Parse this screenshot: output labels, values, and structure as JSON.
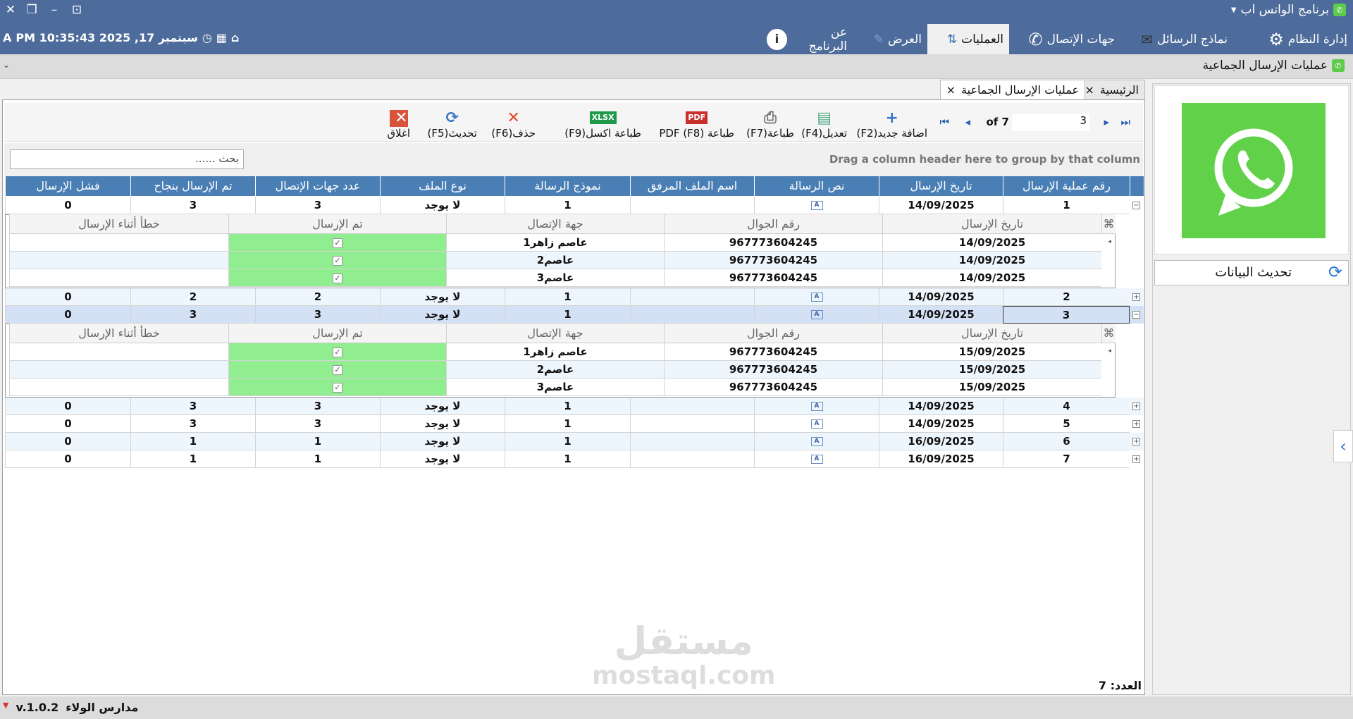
{
  "app": {
    "title": "برنامج الواتس اب",
    "window_controls": [
      "close",
      "restore",
      "minimize",
      "pin"
    ]
  },
  "ribbon": {
    "tabs": [
      {
        "label": "إدارة النظام",
        "icon": "gears-icon"
      },
      {
        "label": "نماذج الرسائل",
        "icon": "envelope-icon"
      },
      {
        "label": "جهات الإتصال",
        "icon": "phone-icon"
      },
      {
        "label": "العمليات",
        "icon": "arrows-updown-icon",
        "active": true
      },
      {
        "label": "العرض",
        "icon": "ruler-pen-icon"
      },
      {
        "label": "عن البرنامج",
        "icon": "info-icon"
      }
    ]
  },
  "clock": {
    "text": "PM 10:35:43 2025 ,17 سبتمبر"
  },
  "breadcrumb": "عمليات الإرسال الجماعية",
  "doc_tabs": [
    {
      "label": "الرئيسية"
    },
    {
      "label": "عمليات الإرسال الجماعية",
      "active": true
    }
  ],
  "toolbar": {
    "add": "اضافة جديد(F2)",
    "edit": "تعديل(F4)",
    "print": "طباعة(F7)",
    "pdf": "طباعة PDF (F8)",
    "excel": "طباعة اكسل(F9)",
    "delete": "حذف(F6)",
    "refresh": "تحديث(F5)",
    "close": "اغلاق",
    "page_current": "3",
    "page_of": "of 7"
  },
  "search": {
    "placeholder": "بحث ......"
  },
  "group_hint": "Drag a column header here to group by that column",
  "grid": {
    "columns": [
      "رقم عملية الإرسال",
      "تاريخ الإرسال",
      "نص الرسالة",
      "اسم الملف المرفق",
      "نموذج الرسالة",
      "نوع الملف",
      "عدد جهات الإتصال",
      "تم الإرسال بنجاح",
      "فشل الإرسال"
    ],
    "rows": [
      {
        "id": "1",
        "date": "14/09/2025",
        "file": "",
        "template": "1",
        "type": "لا يوجد",
        "contacts": "3",
        "success": "3",
        "failed": "0",
        "expanded": true,
        "details": [
          {
            "date": "14/09/2025",
            "phone": "967773604245",
            "contact": "عاصم زاهر1",
            "sent": true,
            "error": ""
          },
          {
            "date": "14/09/2025",
            "phone": "967773604245",
            "contact": "عاصم2",
            "sent": true,
            "error": ""
          },
          {
            "date": "14/09/2025",
            "phone": "967773604245",
            "contact": "عاصم3",
            "sent": true,
            "error": ""
          }
        ]
      },
      {
        "id": "2",
        "date": "14/09/2025",
        "file": "",
        "template": "1",
        "type": "لا يوجد",
        "contacts": "2",
        "success": "2",
        "failed": "0"
      },
      {
        "id": "3",
        "date": "14/09/2025",
        "file": "",
        "template": "1",
        "type": "لا يوجد",
        "contacts": "3",
        "success": "3",
        "failed": "0",
        "expanded": true,
        "selected": true,
        "details": [
          {
            "date": "15/09/2025",
            "phone": "967773604245",
            "contact": "عاصم زاهر1",
            "sent": true,
            "error": ""
          },
          {
            "date": "15/09/2025",
            "phone": "967773604245",
            "contact": "عاصم2",
            "sent": true,
            "error": ""
          },
          {
            "date": "15/09/2025",
            "phone": "967773604245",
            "contact": "عاصم3",
            "sent": true,
            "error": ""
          }
        ]
      },
      {
        "id": "4",
        "date": "14/09/2025",
        "file": "",
        "template": "1",
        "type": "لا يوجد",
        "contacts": "3",
        "success": "3",
        "failed": "0"
      },
      {
        "id": "5",
        "date": "14/09/2025",
        "file": "",
        "template": "1",
        "type": "لا يوجد",
        "contacts": "3",
        "success": "3",
        "failed": "0"
      },
      {
        "id": "6",
        "date": "16/09/2025",
        "file": "",
        "template": "1",
        "type": "لا يوجد",
        "contacts": "1",
        "success": "1",
        "failed": "0"
      },
      {
        "id": "7",
        "date": "16/09/2025",
        "file": "",
        "template": "1",
        "type": "لا يوجد",
        "contacts": "1",
        "success": "1",
        "failed": "0"
      }
    ],
    "detail_columns": [
      "تاريخ الإرسال",
      "رقم الجوال",
      "جهة الإتصال",
      "تم الإرسال",
      "خطأ أثناء الإرسال"
    ]
  },
  "footer": {
    "count": "العدد: 7"
  },
  "sidebar": {
    "refresh_label": "تحديث البيانات"
  },
  "status": {
    "version": "v.1.0.2",
    "org": "مدارس الولاء"
  },
  "watermark": {
    "text": "مستقل",
    "url": "mostaql.com"
  },
  "colors": {
    "titlebar": "#4e6c9b",
    "header": "#4a7fb5",
    "sent_cell": "#90ee90",
    "selected_row": "#d4e1f5",
    "whatsapp": "#62d14a"
  }
}
